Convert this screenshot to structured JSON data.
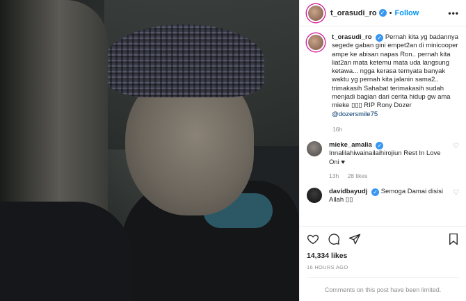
{
  "post": {
    "author": {
      "username": "t_orasudi_ro",
      "verified": true,
      "follow_label": "Follow",
      "separator": "•"
    },
    "more_label": "•••",
    "caption": {
      "username": "t_orasudi_ro",
      "text": "Pernah kita yg badannya segede gaban gini empet2an di minicooper ampe ke abisan napas Ron.. pernah kita liat2an mata ketemu mata uda langsung ketawa... ngga kerasa ternyata banyak waktu yg pernah kita jalanin sama2.. trimakasih Sahabat terimakasih sudah menjadi bagian dari cerita hidup gw ama mieke ▯▯▯ RIP Rony Dozer ",
      "mention": "@dozersmile75",
      "time": "16h"
    },
    "comments": [
      {
        "username": "mieke_amalia",
        "verified": true,
        "text": "Innalilahiwainailaihirojiun Rest In Love Oni ♥",
        "time": "13h",
        "likes": "28 likes"
      },
      {
        "username": "davidbayudj",
        "verified": true,
        "text": "Semoga Damai disisi Allah ▯▯",
        "time": "",
        "likes": ""
      }
    ],
    "likes": "14,334 likes",
    "posted_ago": "16 HOURS AGO",
    "comments_limited": "Comments on this post have been limited.",
    "icons": [
      "heart-icon",
      "comment-icon",
      "share-icon",
      "bookmark-icon"
    ]
  }
}
